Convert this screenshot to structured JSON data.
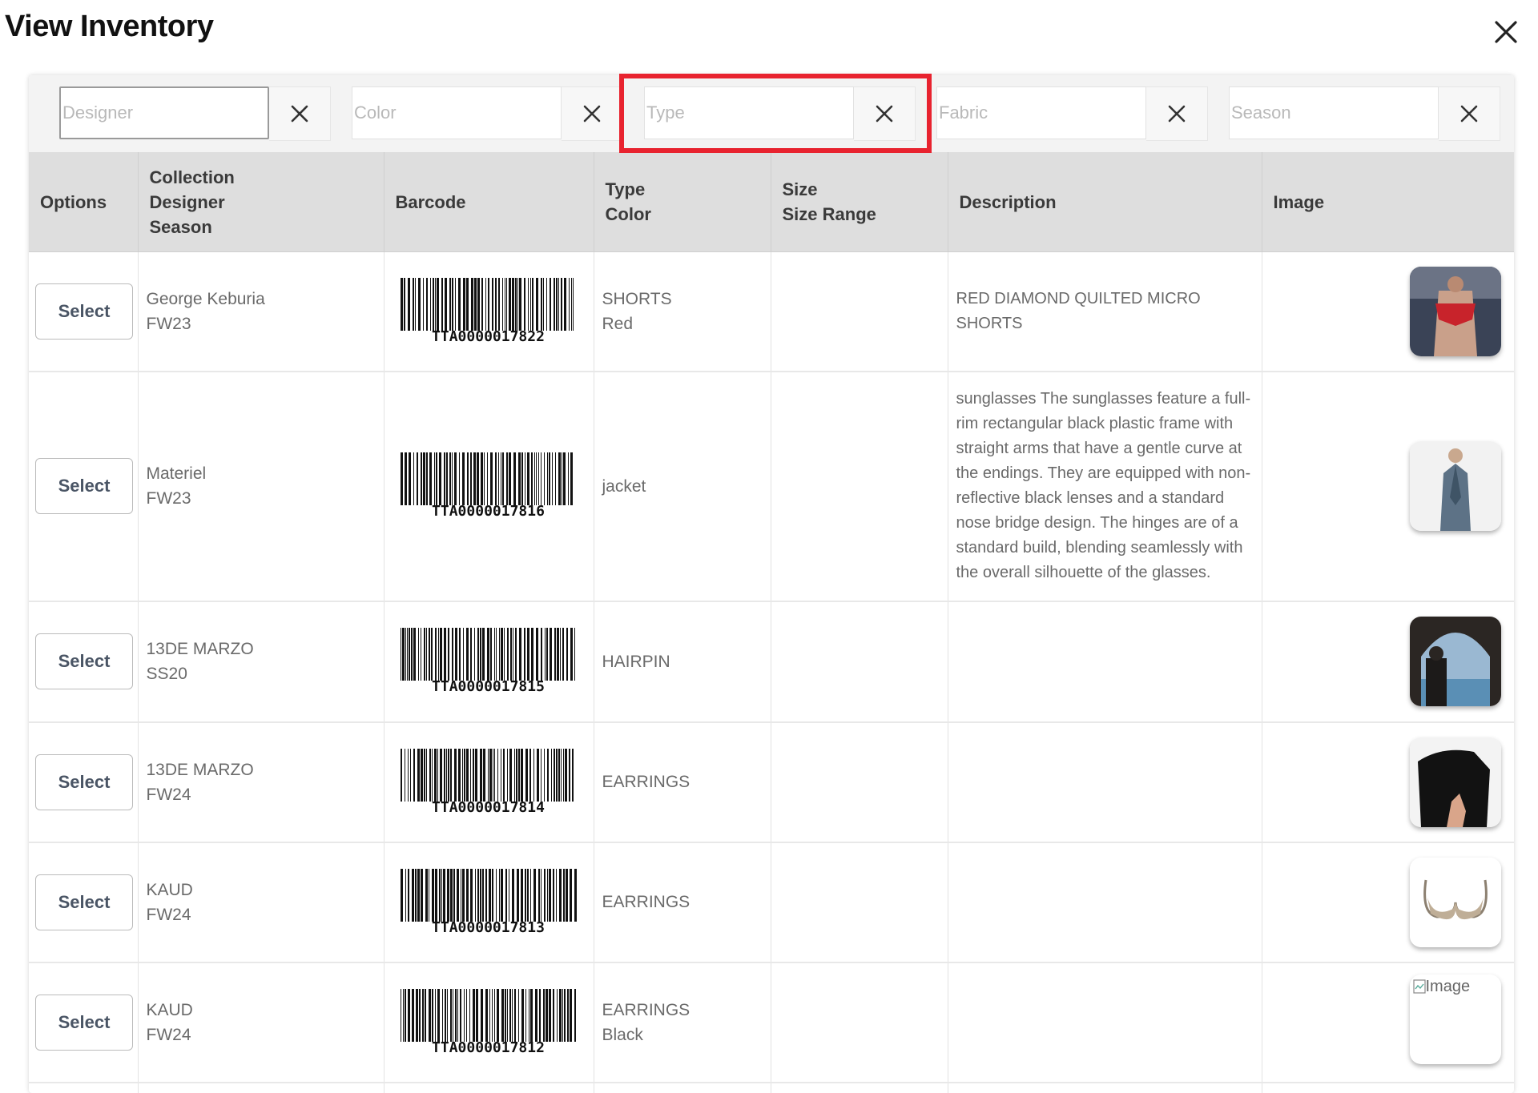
{
  "page": {
    "title": "View Inventory"
  },
  "filters": [
    {
      "placeholder": "Designer",
      "value": ""
    },
    {
      "placeholder": "Color",
      "value": ""
    },
    {
      "placeholder": "Type",
      "value": ""
    },
    {
      "placeholder": "Fabric",
      "value": ""
    },
    {
      "placeholder": "Season",
      "value": ""
    }
  ],
  "table": {
    "headers": {
      "options": "Options",
      "collection": "Collection",
      "designer": "Designer",
      "season": "Season",
      "barcode": "Barcode",
      "type": "Type",
      "color": "Color",
      "size": "Size",
      "size_range": "Size Range",
      "description": "Description",
      "image": "Image"
    },
    "select_label": "Select",
    "rows": [
      {
        "designer": "George Keburia",
        "season": "FW23",
        "barcode": "TTA0000017822",
        "type": "SHORTS",
        "color": "Red",
        "size": "",
        "size_range": "",
        "description": "RED DIAMOND QUILTED MICRO SHORTS",
        "image": "runway-shorts-photo"
      },
      {
        "designer": "Materiel",
        "season": "FW23",
        "barcode": "TTA0000017816",
        "type": "jacket",
        "color": "",
        "size": "",
        "size_range": "",
        "description": "sunglasses The sunglasses feature a full-rim rectangular black plastic frame with straight arms that have a gentle curve at the endings. They are equipped with non-reflective black lenses and a standard nose bridge design. The hinges are of a standard build, blending seamlessly with the overall silhouette of the glasses.",
        "image": "blue-suit-photo"
      },
      {
        "designer": "13DE MARZO",
        "season": "SS20",
        "barcode": "TTA0000017815",
        "type": "HAIRPIN",
        "color": "",
        "size": "",
        "size_range": "",
        "description": "",
        "image": "arch-sea-photo"
      },
      {
        "designer": "13DE MARZO",
        "season": "FW24",
        "barcode": "TTA0000017814",
        "type": "EARRINGS",
        "color": "",
        "size": "",
        "size_range": "",
        "description": "",
        "image": "dark-figure-photo"
      },
      {
        "designer": "KAUD",
        "season": "FW24",
        "barcode": "TTA0000017813",
        "type": "EARRINGS",
        "color": "",
        "size": "",
        "size_range": "",
        "description": "",
        "image": "bra-photo"
      },
      {
        "designer": "KAUD",
        "season": "FW24",
        "barcode": "TTA0000017812",
        "type": "EARRINGS",
        "color": "Black",
        "size": "",
        "size_range": "",
        "description": "",
        "image": "broken-image",
        "image_alt": "Image"
      }
    ]
  },
  "highlight": {
    "target": "type-filter",
    "color": "#e8232f"
  }
}
